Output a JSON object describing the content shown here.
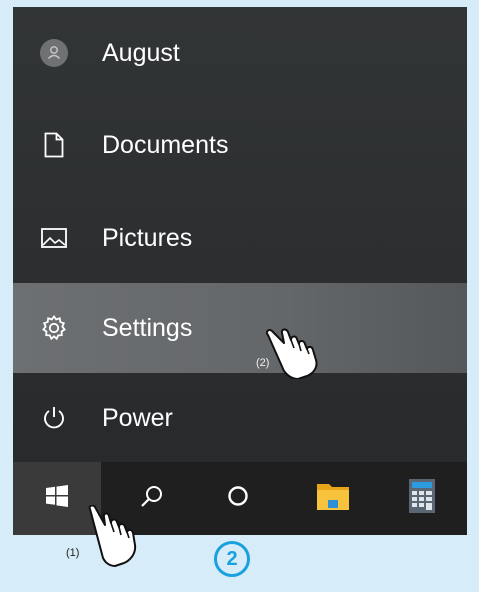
{
  "start_menu": {
    "items": [
      {
        "label": "August",
        "icon": "user-avatar-icon"
      },
      {
        "label": "Documents",
        "icon": "document-icon"
      },
      {
        "label": "Pictures",
        "icon": "pictures-icon"
      },
      {
        "label": "Settings",
        "icon": "gear-icon"
      },
      {
        "label": "Power",
        "icon": "power-icon"
      }
    ]
  },
  "taskbar": {
    "items": [
      {
        "icon": "windows-start-icon"
      },
      {
        "icon": "search-icon"
      },
      {
        "icon": "task-view-icon"
      },
      {
        "icon": "file-explorer-icon"
      },
      {
        "icon": "calculator-icon"
      }
    ]
  },
  "annotations": {
    "step1": "(1)",
    "step2": "(2)",
    "badge": "2"
  },
  "colors": {
    "background": "#d6ecf8",
    "menu": "#2c2e30",
    "highlight": "#64676a",
    "taskbar": "#1f1f1f",
    "badge": "#19a0de",
    "explorer": "#f5b21e"
  }
}
